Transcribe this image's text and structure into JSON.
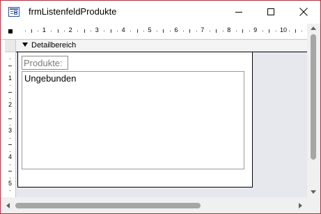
{
  "window": {
    "title": "frmListenfeldProdukte",
    "icon": "form-design-icon",
    "accent_color": "#b03040"
  },
  "ruler": {
    "top_numbers": [
      "1",
      "2",
      "3",
      "4",
      "5",
      "6",
      "7",
      "8",
      "9",
      "10",
      "1"
    ],
    "left_numbers": [
      "1",
      "2",
      "3",
      "4",
      "5"
    ]
  },
  "section": {
    "label": "Detailbereich"
  },
  "form": {
    "label_text": "Produkte:",
    "listbox_text": "Ungebunden"
  },
  "colors": {
    "canvas_background": "#e6e8ed",
    "scrollbar_thumb": "#a6a6a6"
  }
}
